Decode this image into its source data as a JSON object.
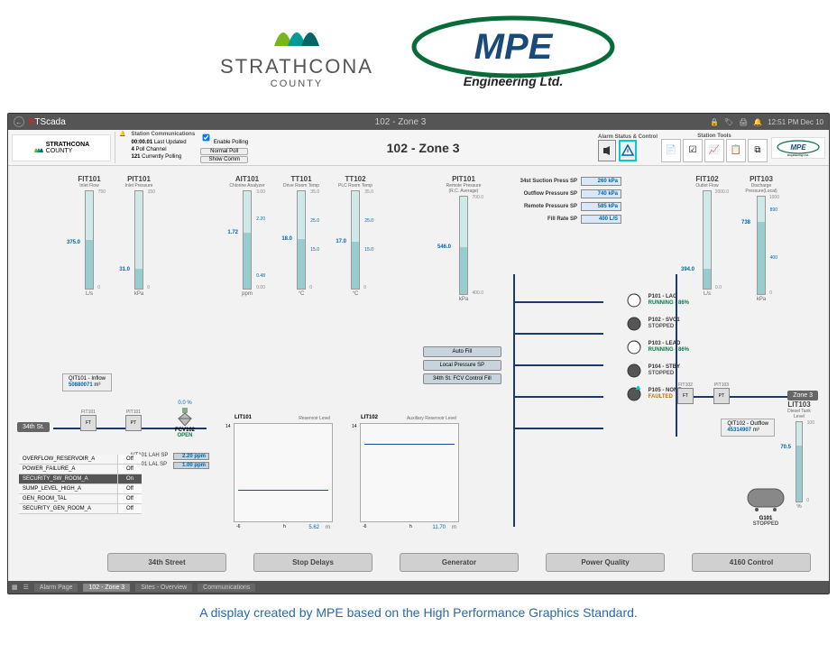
{
  "logos": {
    "strathcona": "STRATHCONA",
    "strathcona_sub": "COUNTY",
    "mpe": "MPE",
    "mpe_sub": "Engineering Ltd."
  },
  "titlebar": {
    "brand1": "V r",
    "brand2": "Scada",
    "title": "102 - Zone 3",
    "time": "12:51 PM  Dec 10",
    "user": "MPE"
  },
  "header": {
    "strath": "STRATHCONA",
    "strath_sub": "COUNTY",
    "station_comm_title": "Station Communications",
    "last_updated_lbl": "Last Updated",
    "last_updated": "00:00.01",
    "poll_ch_lbl": "Poll Channel",
    "poll_ch": "4",
    "cur_poll_lbl": "Currently Polling",
    "cur_poll": "121",
    "enable_poll": "Enable Polling",
    "normal_poll": "Normal Poll",
    "show_comm": "Show Comm",
    "title": "102 - Zone 3",
    "alarm_title": "Alarm Status & Control",
    "tools_title": "Station Tools",
    "mpe": "MPE",
    "mpe_sub": "Engineering Ltd."
  },
  "bars": {
    "fit101": {
      "title": "FIT101",
      "sub": "Inlet Flow",
      "top": "750",
      "val": "375.0",
      "unit": "L/s",
      "bot": "0"
    },
    "pit101": {
      "title": "PIT101",
      "sub": "Inlet Pressure",
      "top": "150",
      "val": "31.0",
      "unit": "kPa",
      "bot": "0"
    },
    "ait101": {
      "title": "AIT101",
      "sub": "Chlorine Analyzer",
      "top": "3.00",
      "t1": "2.20",
      "val": "1.72",
      "t2": "0.48",
      "unit": "ppm",
      "bot": "0.00"
    },
    "tt101": {
      "title": "TT101",
      "sub": "Drive Room Temp",
      "top": "35.0",
      "t1": "25.0",
      "val": "18.0",
      "t2": "15.0",
      "unit": "°C",
      "bot": "0"
    },
    "tt102": {
      "title": "TT102",
      "sub": "PLC Room Temp",
      "top": "35.0",
      "t1": "25.0",
      "val": "17.0",
      "t2": "15.0",
      "unit": "°C",
      "bot": "0"
    },
    "pit101r": {
      "title": "PIT101",
      "sub": "Remote Pressure (R.C. Average)",
      "top": "700.0",
      "val": "546.0",
      "unit": "kPa",
      "bot": "400.0"
    },
    "fit102": {
      "title": "FIT102",
      "sub": "Outlet Flow",
      "top": "2000.0",
      "val": "394.0",
      "unit": "L/s",
      "bot": "0.0"
    },
    "pit103": {
      "title": "PIT103",
      "sub": "Discharge Pressure(Local)",
      "top": "1000",
      "t1": "890",
      "val": "738",
      "t2": "400",
      "unit": "kPa",
      "bot": "0"
    },
    "lit103": {
      "title": "LIT103",
      "sub": "Diesel Tank Level",
      "top": "100",
      "val": "70.5",
      "unit": "%",
      "bot": "0"
    }
  },
  "setpoints": {
    "r1": {
      "lbl": "34st Suction Press SP",
      "val": "260 kPa"
    },
    "r2": {
      "lbl": "Outflow Pressure SP",
      "val": "740 kPa"
    },
    "r3": {
      "lbl": "Remote Pressure SP",
      "val": "585 kPa"
    },
    "r4": {
      "lbl": "Fill Rate SP",
      "val": "400 L/S"
    }
  },
  "pumps": {
    "p101": {
      "name": "P101 - LAG",
      "stat": "RUNNING - 86%",
      "cls": "run"
    },
    "p102": {
      "name": "P102 - SVC1",
      "stat": "STOPPED",
      "cls": "stop"
    },
    "p103": {
      "name": "P103 - LEAD",
      "stat": "RUNNING - 86%",
      "cls": "run"
    },
    "p104": {
      "name": "P104 - STBY",
      "stat": "STOPPED",
      "cls": "stop"
    },
    "p105": {
      "name": "P105 - NONE",
      "stat": "FAULTED",
      "cls": "fault"
    }
  },
  "qit": {
    "q1": {
      "lbl": "QIT101 - Inflow",
      "val": "50880071",
      "unit": "m³"
    },
    "q2": {
      "lbl": "QIT102 - Outflow",
      "val": "45314907",
      "unit": "m³"
    }
  },
  "ctr_btns": {
    "b1": "Auto Fill",
    "b2": "Local Pressure SP",
    "b3": "34th St. FCV Control Fill"
  },
  "src": {
    "left": "34th St.",
    "right": "Zone 3"
  },
  "fcv": {
    "lbl": "FCV102",
    "stat": "OPEN",
    "pct": "0.0 %"
  },
  "ait_sp": {
    "r1l": "AIT101 LAH SP",
    "r1v": "2.20 ppm",
    "r2l": "AIT101 LAL SP",
    "r2v": "1.00 ppm"
  },
  "trends": {
    "lit101": {
      "title": "LIT101",
      "sub": "Reservoir Level",
      "y": "14",
      "x1": "-6",
      "x2": "h",
      "val": "5.62",
      "u": "m"
    },
    "lit102": {
      "title": "LIT102",
      "sub": "Auxiliary Reservoir Level",
      "y": "14",
      "x1": "-6",
      "x2": "h",
      "val": "11.70",
      "u": "m"
    }
  },
  "disc": {
    "r1": {
      "n": "OVERFLOW_RESERVOIR_A",
      "v": "Off"
    },
    "r2": {
      "n": "POWER_FAILURE_A",
      "v": "Off"
    },
    "r3": {
      "n": "SECURITY_SW_ROOM_A",
      "v": "On"
    },
    "r4": {
      "n": "SUMP_LEVEL_HIGH_A",
      "v": "Off"
    },
    "r5": {
      "n": "GEN_ROOM_TAL",
      "v": "Off"
    },
    "r6": {
      "n": "SECURITY_GEN_ROOM_A",
      "v": "Off"
    }
  },
  "flow_tags": {
    "fit101": "FIT101",
    "pit101": "PIT101",
    "fit102": "FIT102",
    "pit103": "PIT103"
  },
  "tank": {
    "lbl": "G101",
    "stat": "STOPPED"
  },
  "navbtns": {
    "b1": "34th Street",
    "b2": "Stop Delays",
    "b3": "Generator",
    "b4": "Power Quality",
    "b5": "4160 Control"
  },
  "statusbar": {
    "t1": "Alarm Page",
    "t2": "102 - Zone 3",
    "t3": "Sites - Overview",
    "t4": "Communications"
  },
  "caption": "A display created by MPE based on the High Performance Graphics Standard."
}
